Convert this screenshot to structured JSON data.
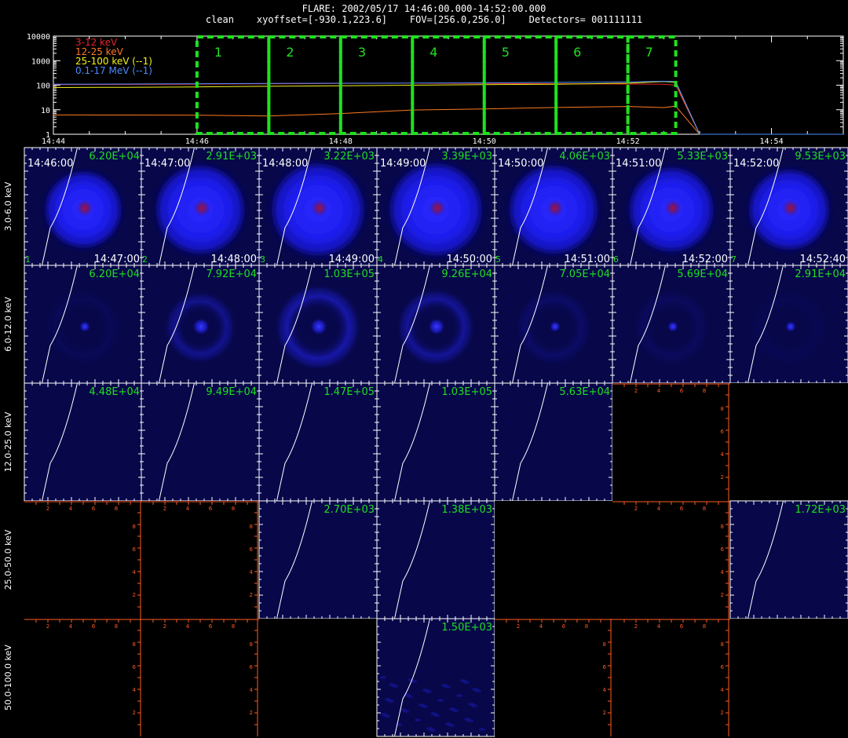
{
  "header": {
    "title": "FLARE: 2002/05/17 14:46:00.000-14:52:00.000",
    "subtitle": "clean    xyoffset=[-930.1,223.6]    FOV=[256.0,256.0]    Detectors= 001111111"
  },
  "lightcurve": {
    "type": "line",
    "y_scale": "log",
    "ylim": [
      1,
      10000
    ],
    "y_ticks": [
      "1",
      "10",
      "100",
      "1000",
      "10000"
    ],
    "x_ticks": [
      "14:44",
      "14:46",
      "14:48",
      "14:50",
      "14:52",
      "14:54"
    ],
    "xlim_minutes": [
      0,
      11
    ],
    "series": [
      {
        "name": "3-12 keV",
        "color": "#e8222a"
      },
      {
        "name": "12-25 keV",
        "color": "#ff7a1f"
      },
      {
        "name": "25-100 keV (--1)",
        "color": "#f2f21a"
      },
      {
        "name": "0.1-17 MeV (--1)",
        "color": "#4a8cff"
      }
    ],
    "intervals": [
      "1",
      "2",
      "3",
      "4",
      "5",
      "6",
      "7"
    ],
    "interval_color": "#1fe01f"
  },
  "chart_data": {
    "type": "line",
    "title": "FLARE: 2002/05/17 14:46:00.000-14:52:00.000",
    "x_unit": "UT",
    "x": [
      "14:44",
      "14:45",
      "14:46",
      "14:47",
      "14:48",
      "14:49",
      "14:50",
      "14:51",
      "14:52",
      "14:52:30",
      "14:52:40",
      "14:53",
      "14:54",
      "14:55"
    ],
    "series": [
      {
        "name": "3-12 keV",
        "values": [
          105,
          107,
          110,
          113,
          118,
          120,
          118,
          115,
          112,
          110,
          100,
          1,
          1,
          1
        ]
      },
      {
        "name": "12-25 keV",
        "values": [
          5,
          5,
          6,
          7,
          9,
          10,
          9,
          10,
          13,
          15,
          14,
          1,
          1,
          1
        ]
      },
      {
        "name": "25-100 keV (--1)",
        "values": [
          80,
          82,
          85,
          90,
          95,
          100,
          105,
          110,
          120,
          140,
          130,
          1,
          1,
          1
        ]
      },
      {
        "name": "0.1-17 MeV (--1)",
        "values": [
          110,
          112,
          115,
          118,
          120,
          122,
          125,
          130,
          135,
          145,
          140,
          1,
          1,
          1
        ]
      }
    ],
    "ylim": [
      1,
      10000
    ],
    "y_scale": "log"
  },
  "image_grid": {
    "columns": [
      {
        "interval": "1",
        "start": "14:46:00",
        "end": "14:47:00"
      },
      {
        "interval": "2",
        "start": "14:47:00",
        "end": "14:48:00"
      },
      {
        "interval": "3",
        "start": "14:48:00",
        "end": "14:49:00"
      },
      {
        "interval": "4",
        "start": "14:49:00",
        "end": "14:50:00"
      },
      {
        "interval": "5",
        "start": "14:50:00",
        "end": "14:51:00"
      },
      {
        "interval": "6",
        "start": "14:51:00",
        "end": "14:52:00"
      },
      {
        "interval": "7",
        "start": "14:52:00",
        "end": "14:52:40"
      }
    ],
    "rows": [
      {
        "label": "3.0-6.0 keV",
        "cells": [
          {
            "max": "6.20E+04",
            "kind": "disk",
            "halo": 0.8
          },
          {
            "max": "2.91E+03",
            "kind": "disk",
            "halo": 0.95
          },
          {
            "max": "3.22E+03",
            "kind": "disk",
            "halo": 1.0
          },
          {
            "max": "3.39E+03",
            "kind": "disk",
            "halo": 1.0
          },
          {
            "max": "4.06E+03",
            "kind": "disk",
            "halo": 0.95
          },
          {
            "max": "5.33E+03",
            "kind": "disk",
            "halo": 0.9
          },
          {
            "max": "9.53E+03",
            "kind": "disk",
            "halo": 0.85
          }
        ]
      },
      {
        "label": "6.0-12.0 keV",
        "cells": [
          {
            "max": "6.20E+04",
            "kind": "faint",
            "halo": 0.05
          },
          {
            "max": "7.92E+04",
            "kind": "ring",
            "halo": 0.35
          },
          {
            "max": "1.03E+05",
            "kind": "ring",
            "halo": 0.7
          },
          {
            "max": "9.26E+04",
            "kind": "ring",
            "halo": 0.5
          },
          {
            "max": "7.05E+04",
            "kind": "faint",
            "halo": 0.12
          },
          {
            "max": "5.69E+04",
            "kind": "faint",
            "halo": 0.08
          },
          {
            "max": "2.91E+04",
            "kind": "faint",
            "halo": 0.04
          }
        ]
      },
      {
        "label": "12.0-25.0 keV",
        "cells": [
          {
            "max": "4.48E+04",
            "kind": "empty"
          },
          {
            "max": "9.49E+04",
            "kind": "empty"
          },
          {
            "max": "1.47E+05",
            "kind": "empty"
          },
          {
            "max": "1.03E+05",
            "kind": "empty"
          },
          {
            "max": "5.63E+04",
            "kind": "empty"
          },
          {
            "max": "",
            "kind": "axes"
          },
          {
            "max": "",
            "kind": "blank"
          }
        ]
      },
      {
        "label": "25.0-50.0 keV",
        "cells": [
          {
            "max": "",
            "kind": "axes"
          },
          {
            "max": "",
            "kind": "axes"
          },
          {
            "max": "2.70E+03",
            "kind": "empty"
          },
          {
            "max": "1.38E+03",
            "kind": "empty"
          },
          {
            "max": "",
            "kind": "blank"
          },
          {
            "max": "",
            "kind": "axes"
          },
          {
            "max": "1.72E+03",
            "kind": "empty"
          }
        ]
      },
      {
        "label": "50.0-100.0 keV",
        "cells": [
          {
            "max": "",
            "kind": "axes"
          },
          {
            "max": "",
            "kind": "axes"
          },
          {
            "max": "",
            "kind": "blank"
          },
          {
            "max": "1.50E+03",
            "kind": "noise"
          },
          {
            "max": "",
            "kind": "axes"
          },
          {
            "max": "",
            "kind": "axes"
          },
          {
            "max": "",
            "kind": "blank"
          }
        ]
      }
    ],
    "axis_ticks": [
      "2",
      "4",
      "6",
      "8"
    ],
    "maxval_color": "#1fe01f",
    "axis_color": "#ff5a1f"
  }
}
